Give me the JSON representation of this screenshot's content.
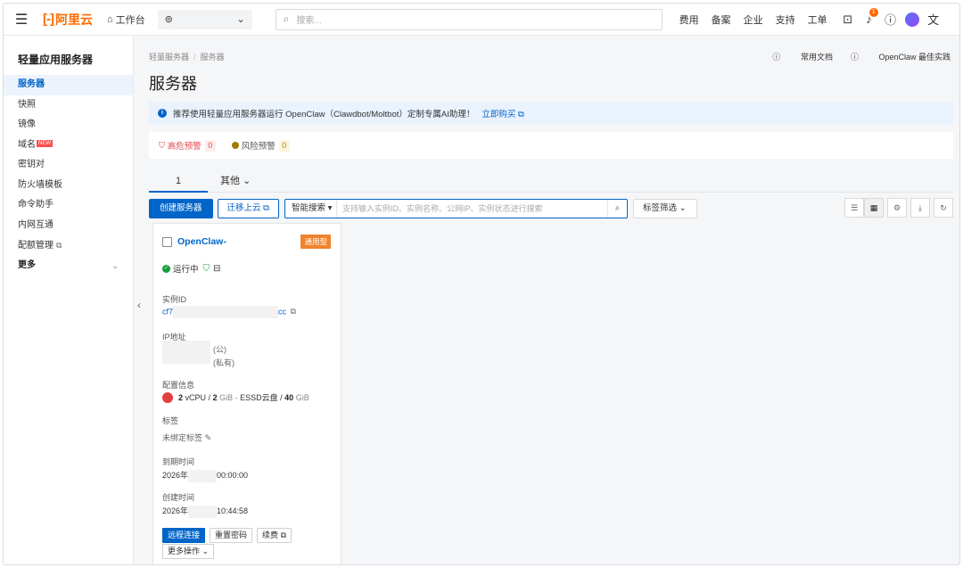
{
  "topbar": {
    "logo_bracket": "[-]",
    "logo_text": "阿里云",
    "workbench": "工作台",
    "region_value": "",
    "search_placeholder": "搜索...",
    "links": [
      "费用",
      "备案",
      "企业",
      "支持",
      "工单"
    ],
    "notification_count": "1"
  },
  "sidebar": {
    "title": "轻量应用服务器",
    "items": [
      {
        "label": "服务器"
      },
      {
        "label": "快照"
      },
      {
        "label": "镜像"
      },
      {
        "label": "域名",
        "badge": "NEW"
      },
      {
        "label": "密钥对"
      },
      {
        "label": "防火墙模板"
      },
      {
        "label": "命令助手"
      },
      {
        "label": "内网互通"
      },
      {
        "label": "配额管理"
      },
      {
        "label": "更多"
      }
    ]
  },
  "main": {
    "breadcrumb": [
      "轻量服务器",
      "服务器"
    ],
    "top_links": [
      "常用文档",
      "OpenClaw 最佳实践"
    ],
    "title": "服务器",
    "notice": {
      "text": "推荐使用轻量应用服务器运行 OpenClaw（Clawdbot/Moltbot）定制专属AI助理！",
      "link": "立即购买"
    },
    "alerts": {
      "high_label": "高危预警",
      "high_count": "0",
      "risk_label": "风险预警",
      "risk_count": "0"
    },
    "tabs": [
      "1",
      "其他"
    ],
    "toolbar": {
      "create": "创建服务器",
      "migrate": "迁移上云",
      "search_type": "智能搜索",
      "search_placeholder": "支持输入实例ID、实例名称、公网IP、实例状态进行搜索",
      "tag_filter": "标签筛选"
    }
  },
  "card": {
    "name": "OpenClaw-",
    "type_tag": "通用型",
    "status": "运行中",
    "instance_id_label": "实例ID",
    "instance_id_prefix": "cf7",
    "instance_id_suffix": "cc",
    "ip_label": "IP地址",
    "ip_public": "(公)",
    "ip_private": "(私有)",
    "config_label": "配置信息",
    "config": {
      "cpu": "2",
      "cpu_unit": "vCPU /",
      "mem": "2",
      "mem_unit": "GiB -",
      "disk_type": "ESSD云盘 /",
      "disk": "40",
      "disk_unit": "GiB"
    },
    "tags_label": "标签",
    "tags_value": "未绑定标签",
    "expire_label": "到期时间",
    "expire_year": "2026年",
    "expire_time": "00:00:00",
    "created_label": "创建时间",
    "created_year": "2026年",
    "created_time": "10:44:58",
    "actions": [
      "远程连接",
      "重置密码",
      "续费"
    ],
    "more": "更多操作"
  },
  "colors": {
    "primary": "#0064c8",
    "brand": "#ff6a00",
    "danger": "#e5484d",
    "success": "#1a9c3e"
  }
}
